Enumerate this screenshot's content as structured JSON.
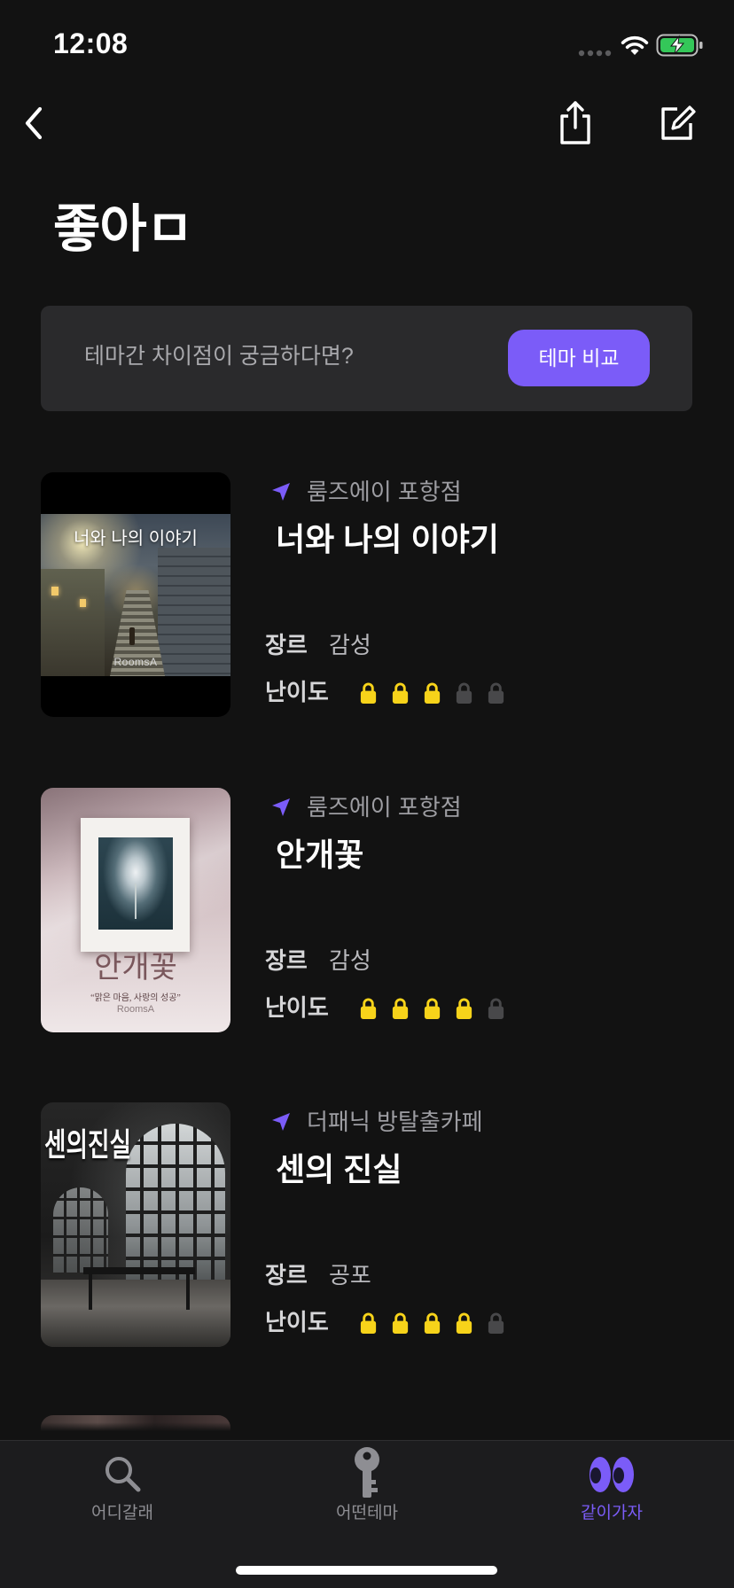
{
  "status_bar": {
    "time": "12:08",
    "icons": [
      "signal-icon",
      "wifi-icon",
      "battery-charging-icon"
    ]
  },
  "nav": {
    "back_icon": "chevron-left-icon",
    "action_icons": [
      "share-icon",
      "edit-icon"
    ]
  },
  "page": {
    "title": "좋아ㅁ"
  },
  "compare_banner": {
    "text": "테마간 차이점이 궁금하다면?",
    "button_label": "테마 비교"
  },
  "labels": {
    "genre": "장르",
    "difficulty": "난이도"
  },
  "themes": [
    {
      "store": "룸즈에이 포항점",
      "title": "너와 나의 이야기",
      "genre": "감성",
      "difficulty": 3,
      "difficulty_max": 5,
      "cover": {
        "title": "너와 나의 이야기",
        "logo": "RoomsA"
      }
    },
    {
      "store": "룸즈에이 포항점",
      "title": "안개꽃",
      "genre": "감성",
      "difficulty": 4,
      "difficulty_max": 5,
      "cover": {
        "title": "안개꽃",
        "subtitle": "“맑은 마음, 사랑의 성공”",
        "logo": "RoomsA"
      }
    },
    {
      "store": "더패닉 방탈출카페",
      "title": "센의 진실",
      "genre": "공포",
      "difficulty": 4,
      "difficulty_max": 5,
      "cover": {
        "title": "센의진실"
      }
    }
  ],
  "tab_bar": {
    "tabs": [
      {
        "label": "어디갈래",
        "icon": "search-icon",
        "active": false
      },
      {
        "label": "어떤테마",
        "icon": "key-icon",
        "active": false
      },
      {
        "label": "같이가자",
        "icon": "eyes-icon",
        "active": true
      }
    ]
  },
  "colors": {
    "background": "#121212",
    "accent": "#7b5cf8",
    "lock_on": "#f7d31a",
    "lock_off": "#48484a",
    "banner": "#2a2a2c",
    "tab_bar": "#1c1c1e",
    "muted": "#8e8e93"
  }
}
